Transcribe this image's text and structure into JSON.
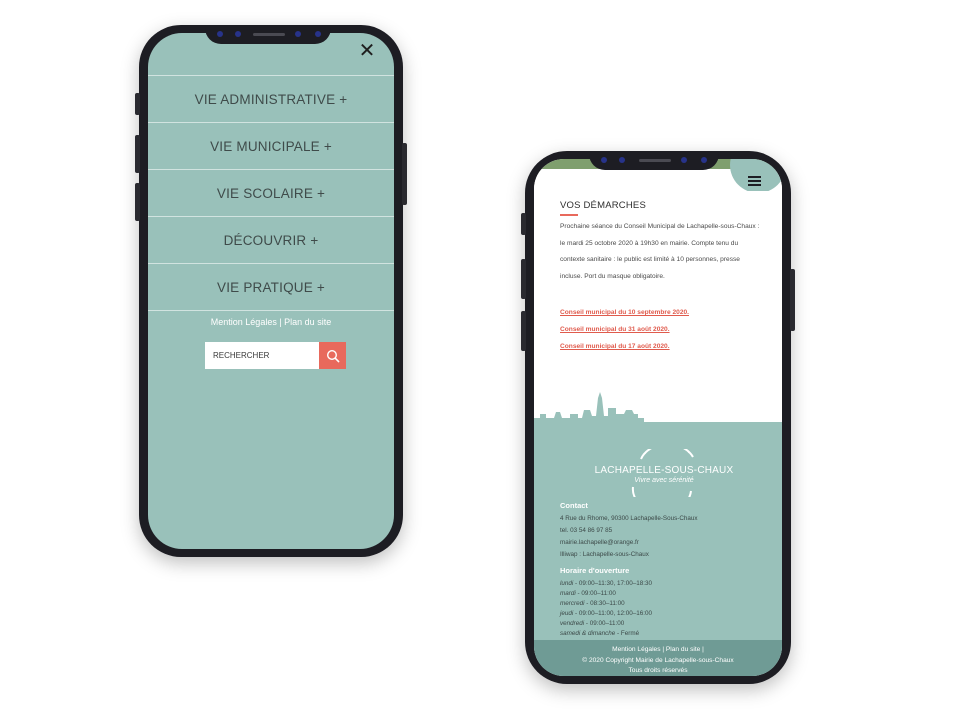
{
  "phone1": {
    "menu": [
      "VIE ADMINISTRATIVE +",
      "VIE MUNICIPALE +",
      "VIE SCOLAIRE +",
      "DÉCOUVRIR +",
      "VIE PRATIQUE +"
    ],
    "footer_links": "Mention Légales | Plan du site",
    "search_label": "RECHERCHER",
    "colors": {
      "menu_bg": "#99c1ba",
      "accent": "#e8695c"
    }
  },
  "phone2": {
    "section_title": "VOS DÉMARCHES",
    "paragraph": "Prochaine séance du Conseil Municipal de Lachapelle-sous-Chaux : le mardi 25 octobre 2020 à 19h30 en mairie. Compte tenu du contexte sanitaire : le public est limité à 10 personnes, presse incluse. Port du masque obligatoire.",
    "links": [
      "Conseil municipal du 10 septembre 2020.",
      "Conseil municipal du 31 août 2020.",
      "Conseil municipal du 17 août 2020."
    ],
    "logo_name": "LACHAPELLE-SOUS-CHAUX",
    "logo_tagline": "Vivre avec sérénité",
    "contact_title": "Contact",
    "contact_lines": [
      "4 Rue du Rhome, 90300 Lachapelle-Sous-Chaux",
      "tel. 03 54 86 97 85",
      "mairie.lachapelle@orange.fr",
      "Illiwap : Lachapelle-sous-Chaux"
    ],
    "hours_title": "Horaire d'ouverture",
    "hours": [
      {
        "day": "lundi",
        "time": " - 09:00–11:30, 17:00–18:30"
      },
      {
        "day": "mardi",
        "time": " - 09:00–11:00"
      },
      {
        "day": "mercredi",
        "time": " - 08:30–11:00"
      },
      {
        "day": "jeudi",
        "time": " - 09:00–11:00, 12:00–16:00"
      },
      {
        "day": "vendredi",
        "time": " -  09:00–11:00"
      },
      {
        "day": "samedi & dimanche",
        "time": " - Fermé"
      }
    ],
    "bottom_links": "Mention Légales | Plan du site |",
    "copyright": "© 2020 Copyright Mairie de  Lachapelle-sous-Chaux",
    "rights": "Tous droits réservés",
    "colors": {
      "footer_bg": "#99c1ba",
      "bottom_bar": "#6f9b95",
      "link": "#e05b4d"
    }
  }
}
